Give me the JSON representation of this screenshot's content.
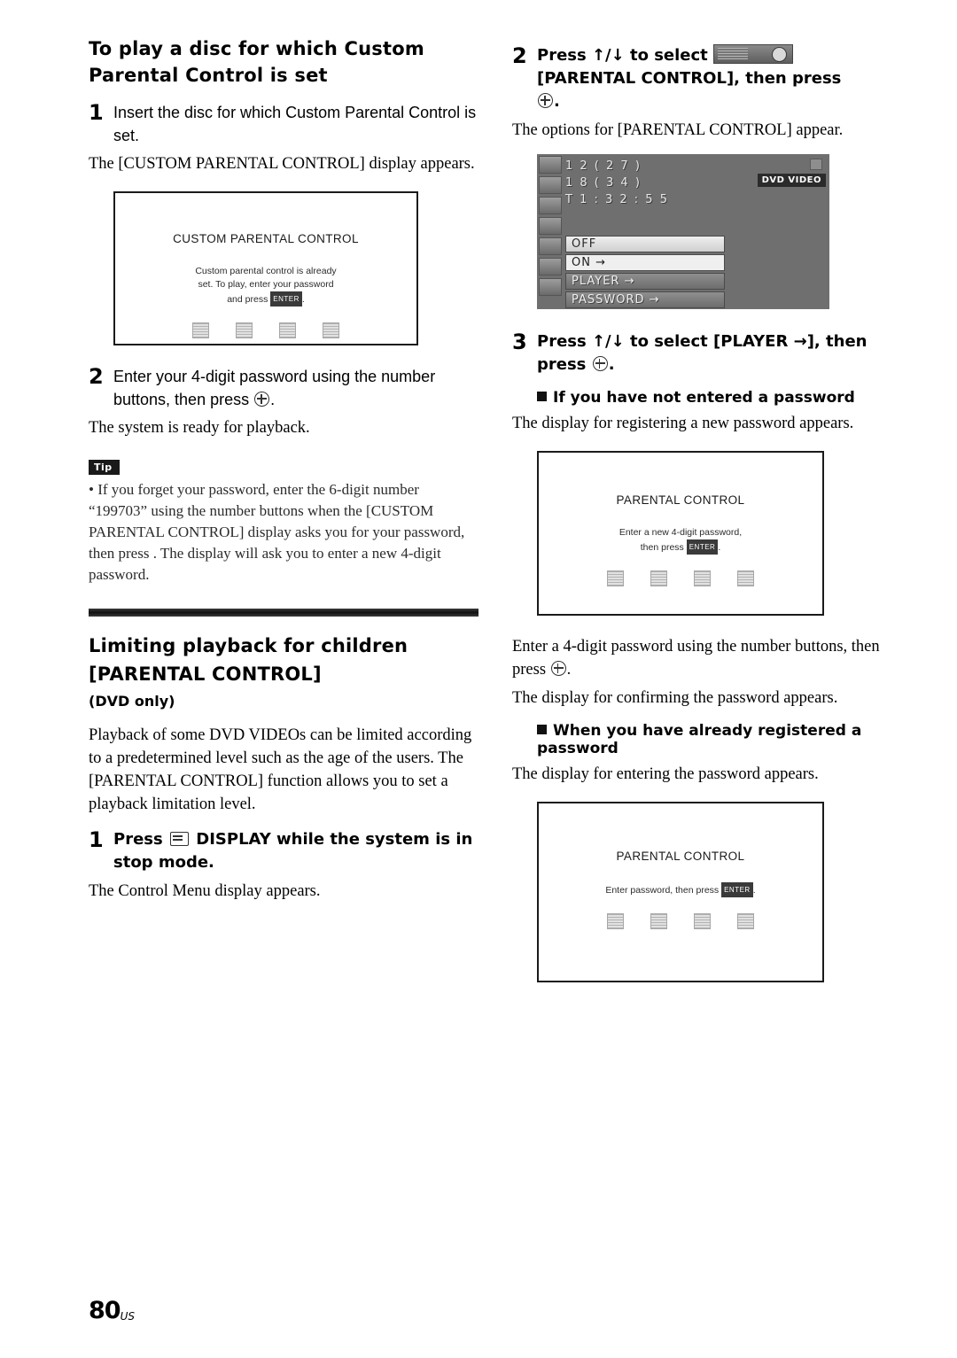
{
  "page": {
    "number": "80",
    "number_suffix": "US"
  },
  "left": {
    "heading": "To play a disc for which Custom Parental Control is set",
    "step1": {
      "num": "1",
      "text": "Insert the disc for which Custom Parental Control is set.",
      "sub": "The [CUSTOM PARENTAL CONTROL] display appears."
    },
    "screen1": {
      "title": "CUSTOM PARENTAL CONTROL",
      "line1": "Custom parental control is already",
      "line2": "set. To play, enter your password",
      "line3_pre": "and press",
      "line3_key": "ENTER",
      "line3_post": "."
    },
    "step2": {
      "num": "2",
      "text_a": "Enter your 4-digit password using the number buttons, then press",
      "text_b": ".",
      "sub": "The system is ready for playback."
    },
    "tip": {
      "label": "Tip",
      "text": "• If you forget your password, enter the 6-digit number “199703” using the number buttons when the [CUSTOM PARENTAL CONTROL] display asks you for your password, then press      . The display will ask you to enter a new 4-digit password."
    },
    "section2": {
      "heading_line1": "Limiting playback for children",
      "heading_line2": "[PARENTAL CONTROL]",
      "subtitle": "(DVD only)",
      "body": "Playback of some DVD VIDEOs can be limited according to a predetermined level such as the age of the users. The [PARENTAL CONTROL] function allows you to set a playback limitation level.",
      "step1": {
        "num": "1",
        "text_pre": "Press",
        "text_post": "DISPLAY while the system is in stop mode.",
        "sub": "The Control Menu display appears."
      }
    }
  },
  "right": {
    "step2": {
      "num": "2",
      "text_pre": "Press ↑/↓ to select",
      "text_mid": "[PARENTAL CONTROL], then press",
      "text_post": ".",
      "sub": "The options for [PARENTAL CONTROL] appear."
    },
    "osd": {
      "line1": "1 2 ( 2 7 )",
      "line2": "1 8 ( 3 4 )",
      "line3": "T    1 : 3 2 : 5 5",
      "badge": "DVD VIDEO",
      "options": [
        "OFF",
        "ON →",
        "PLAYER →",
        "PASSWORD →"
      ],
      "selected": "OFF"
    },
    "step3": {
      "num": "3",
      "text_a": "Press ↑/↓ to select [PLAYER →], then",
      "text_b": "press",
      "text_c": "."
    },
    "sub1": {
      "heading": "If you have not entered a password",
      "body": "The display for registering a new password appears."
    },
    "screen2": {
      "title": "PARENTAL CONTROL",
      "line1": "Enter a new 4-digit password,",
      "line2_pre": "then press",
      "line2_key": "ENTER",
      "line2_post": "."
    },
    "mid_text1": "Enter a 4-digit password using the number buttons, then press",
    "mid_text1_post": ".",
    "mid_text2": "The display for confirming the password appears.",
    "sub2": {
      "heading_line1": "When you have already registered a",
      "heading_line2": "password",
      "body": "The display for entering the password appears."
    },
    "screen3": {
      "title": "PARENTAL CONTROL",
      "line1_pre": "Enter password, then press",
      "line1_key": "ENTER",
      "line1_post": "."
    }
  }
}
